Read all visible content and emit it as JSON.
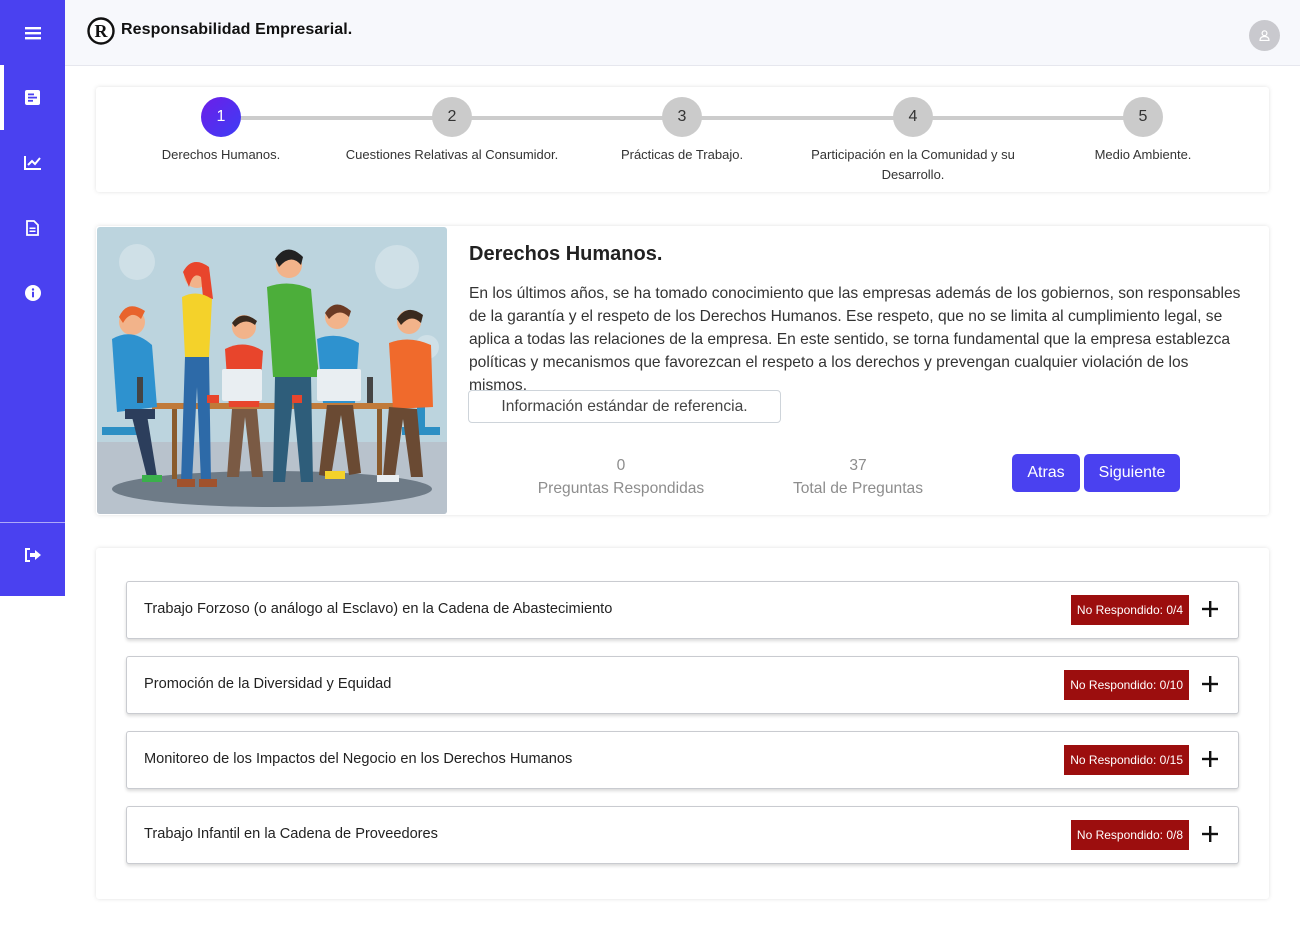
{
  "header": {
    "brand": "Responsabilidad Empresarial."
  },
  "sidebar": {
    "items": [
      {
        "icon": "menu-icon"
      },
      {
        "icon": "document-list-icon",
        "active": true
      },
      {
        "icon": "chart-line-icon"
      },
      {
        "icon": "file-text-icon"
      },
      {
        "icon": "info-icon"
      },
      {
        "icon": "logout-icon"
      }
    ]
  },
  "stepper": {
    "steps": [
      {
        "number": "1",
        "label": "Derechos Humanos.",
        "active": true
      },
      {
        "number": "2",
        "label": "Cuestiones Relativas al Consumidor."
      },
      {
        "number": "3",
        "label": "Prácticas de Trabajo."
      },
      {
        "number": "4",
        "label": "Participación en la Comunidad y su Desarrollo."
      },
      {
        "number": "5",
        "label": "Medio Ambiente."
      }
    ]
  },
  "intro": {
    "title": "Derechos Humanos.",
    "text": "En los últimos años, se ha tomado conocimiento que las empresas además de los gobiernos, son responsables de la garantía y el respeto de los Derechos Humanos. Ese respeto, que no se limita al cumplimiento legal, se aplica a todas las relaciones de la empresa. En este sentido, se torna fundamental que la empresa establezca políticas y mecanismos que favorezcan el respeto a los derechos y prevengan cualquier violación de los mismos.",
    "reference_button": "Información estándar de referencia.",
    "answered_value": "0",
    "answered_label": "Preguntas Respondidas",
    "total_value": "37",
    "total_label": "Total de Preguntas",
    "back_button": "Atras",
    "next_button": "Siguiente"
  },
  "sections": [
    {
      "title": "Trabajo Forzoso (o análogo al Esclavo) en la Cadena de Abastecimiento",
      "status": "No Respondido: 0/4"
    },
    {
      "title": "Promoción de la Diversidad y Equidad",
      "status": "No Respondido: 0/10"
    },
    {
      "title": "Monitoreo de los Impactos del Negocio en los Derechos Humanos",
      "status": "No Respondido: 0/15"
    },
    {
      "title": "Trabajo Infantil en la Cadena de Proveedores",
      "status": "No Respondido: 0/8"
    }
  ],
  "colors": {
    "accent": "#4a41f0",
    "badge": "#9c0e0e",
    "active_step_start": "#6d1ee8",
    "active_step_end": "#3d3df5"
  }
}
